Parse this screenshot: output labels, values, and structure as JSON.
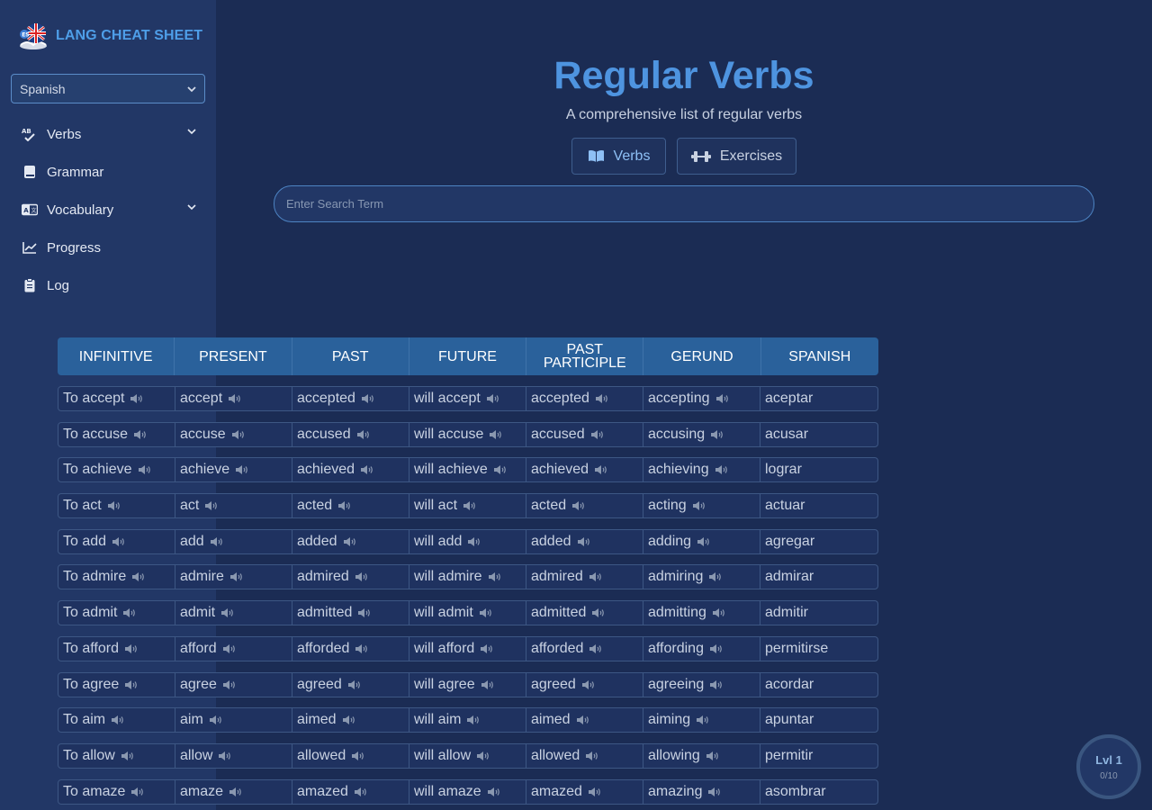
{
  "brand": {
    "name": "LANG CHEAT SHEET"
  },
  "sidebar": {
    "language_select": {
      "value": "Spanish"
    },
    "items": [
      {
        "label": "Verbs",
        "icon": "spell-check-icon",
        "expandable": true
      },
      {
        "label": "Grammar",
        "icon": "book-icon",
        "expandable": false
      },
      {
        "label": "Vocabulary",
        "icon": "language-card-icon",
        "expandable": true
      },
      {
        "label": "Progress",
        "icon": "chart-line-icon",
        "expandable": false
      },
      {
        "label": "Log",
        "icon": "clipboard-icon",
        "expandable": false
      }
    ]
  },
  "main": {
    "title": "Regular Verbs",
    "subtitle": "A comprehensive list of regular verbs",
    "tabs": [
      {
        "label": "Verbs",
        "icon": "open-book-icon",
        "active": true
      },
      {
        "label": "Exercises",
        "icon": "dumbbell-icon",
        "active": false
      }
    ],
    "search": {
      "placeholder": "Enter Search Term"
    }
  },
  "table": {
    "headers": [
      "INFINITIVE",
      "PRESENT",
      "PAST",
      "FUTURE",
      "PAST PARTICIPLE",
      "GERUND",
      "SPANISH"
    ],
    "rows": [
      [
        "To accept",
        "accept",
        "accepted",
        "will accept",
        "accepted",
        "accepting",
        "aceptar"
      ],
      [
        "To accuse",
        "accuse",
        "accused",
        "will accuse",
        "accused",
        "accusing",
        "acusar"
      ],
      [
        "To achieve",
        "achieve",
        "achieved",
        "will achieve",
        "achieved",
        "achieving",
        "lograr"
      ],
      [
        "To act",
        "act",
        "acted",
        "will act",
        "acted",
        "acting",
        "actuar"
      ],
      [
        "To add",
        "add",
        "added",
        "will add",
        "added",
        "adding",
        "agregar"
      ],
      [
        "To admire",
        "admire",
        "admired",
        "will admire",
        "admired",
        "admiring",
        "admirar"
      ],
      [
        "To admit",
        "admit",
        "admitted",
        "will admit",
        "admitted",
        "admitting",
        "admitir"
      ],
      [
        "To afford",
        "afford",
        "afforded",
        "will afford",
        "afforded",
        "affording",
        "permitirse"
      ],
      [
        "To agree",
        "agree",
        "agreed",
        "will agree",
        "agreed",
        "agreeing",
        "acordar"
      ],
      [
        "To aim",
        "aim",
        "aimed",
        "will aim",
        "aimed",
        "aiming",
        "apuntar"
      ],
      [
        "To allow",
        "allow",
        "allowed",
        "will allow",
        "allowed",
        "allowing",
        "permitir"
      ],
      [
        "To amaze",
        "amaze",
        "amazed",
        "will amaze",
        "amazed",
        "amazing",
        "asombrar"
      ]
    ]
  },
  "level_badge": {
    "title": "Lvl 1",
    "progress": "0/10"
  },
  "colors": {
    "background": "#1b2c54",
    "sidebar": "#223766",
    "accent": "#4e94e0",
    "table_header": "#2a619b"
  }
}
